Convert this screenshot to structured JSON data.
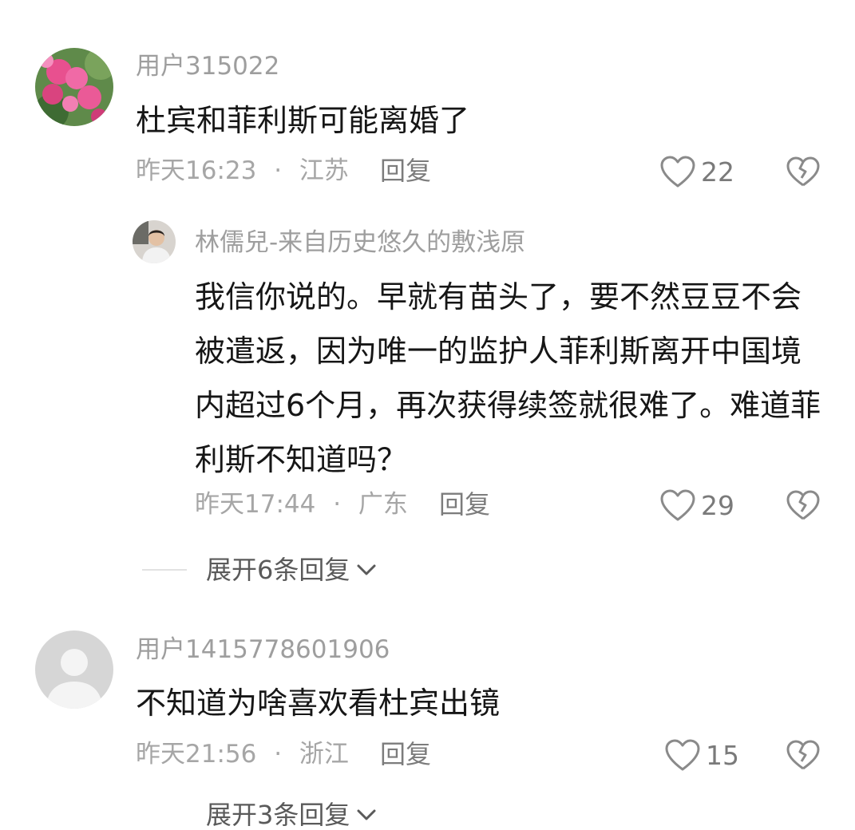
{
  "comments": [
    {
      "username": "用户315022",
      "text": "杜宾和菲利斯可能离婚了",
      "time": "昨天16:23",
      "location": "江苏",
      "reply_label": "回复",
      "likes": "22",
      "reply": {
        "username": "林儒兒-来自历史悠久的敷浅原",
        "text": "我信你说的。早就有苗头了，要不然豆豆不会被遣返，因为唯一的监护人菲利斯离开中国境内超过6个月，再次获得续签就很难了。难道菲利斯不知道吗？",
        "time": "昨天17:44",
        "location": "广东",
        "reply_label": "回复",
        "likes": "29"
      },
      "expand_label": "展开6条回复"
    },
    {
      "username": "用户1415778601906",
      "text": "不知道为啥喜欢看杜宾出镜",
      "time": "昨天21:56",
      "location": "浙江",
      "reply_label": "回复",
      "likes": "15",
      "expand_label": "展开3条回复"
    }
  ],
  "separator": "·",
  "colors": {
    "text": "#161616",
    "meta": "#a6a6a6",
    "icon": "#8a8a8a",
    "background": "#ffffff"
  }
}
